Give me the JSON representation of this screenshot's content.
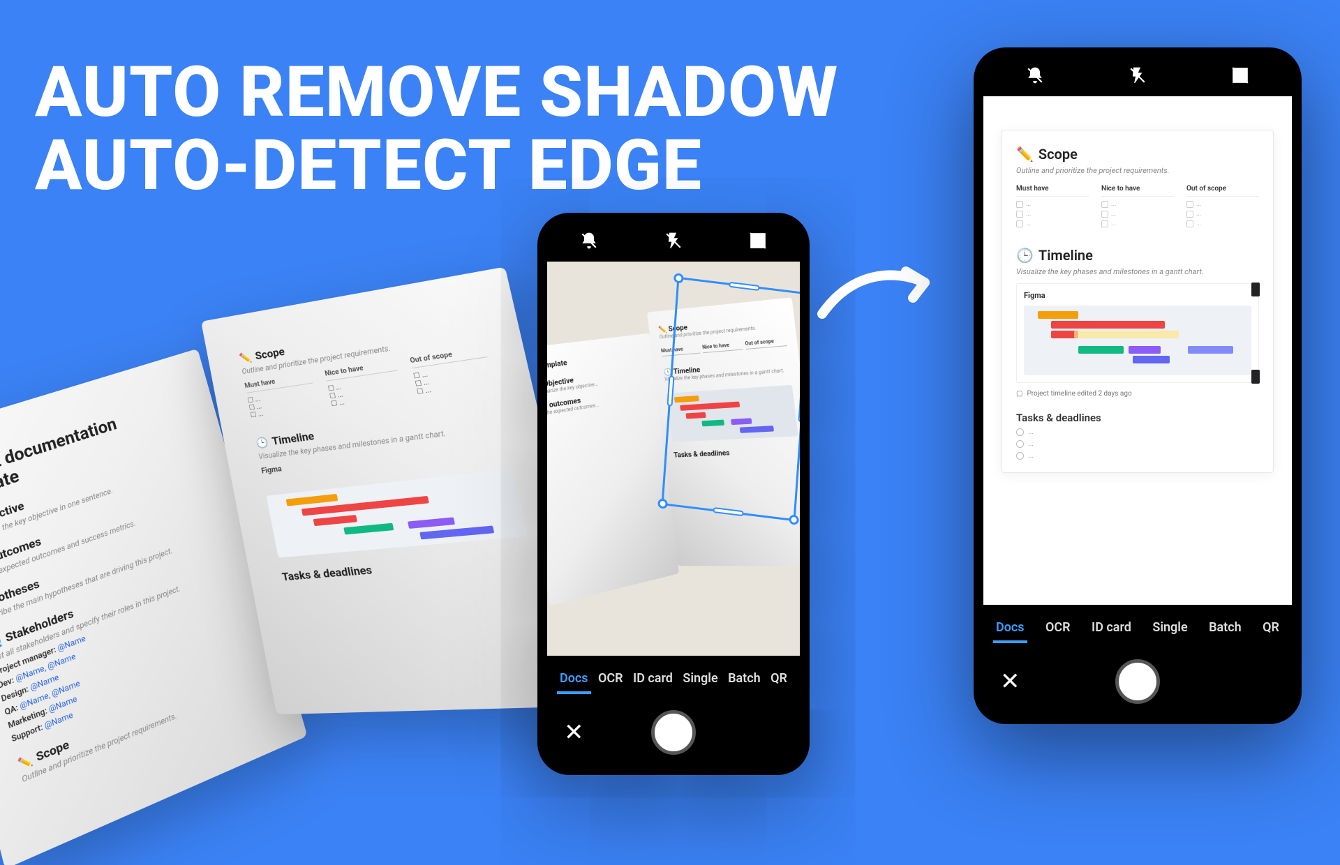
{
  "headline": {
    "line1": "AUTO REMOVE SHADOW",
    "line2": "AUTO-DETECT EDGE"
  },
  "book": {
    "title": "Project documentation template",
    "sections": {
      "objective": {
        "label": "Objective",
        "sub": "Summarize the key objective in one sentence."
      },
      "key_outcomes": {
        "label": "Key outcomes",
        "sub": "List the expected outcomes and success metrics."
      },
      "hypotheses": {
        "label": "Hypotheses",
        "sub": "Describe the main hypotheses that are driving this project."
      },
      "stakeholders": {
        "label": "Stakeholders",
        "sub": "List all stakeholders and specify their roles in this project.",
        "roles": [
          {
            "role": "Project manager:",
            "handle": "@Name"
          },
          {
            "role": "Dev:",
            "handle": "@Name, @Name"
          },
          {
            "role": "Design:",
            "handle": "@Name"
          },
          {
            "role": "QA:",
            "handle": "@Name, @Name"
          },
          {
            "role": "Marketing:",
            "handle": "@Name"
          },
          {
            "role": "Support:",
            "handle": "@Name"
          }
        ]
      },
      "scope_left": {
        "label": "Scope",
        "sub": "Outline and prioritize the project requirements."
      }
    },
    "right": {
      "scope": {
        "label": "Scope",
        "sub": "Outline and prioritize the project requirements.",
        "cols": [
          "Must have",
          "Nice to have",
          "Out of scope"
        ]
      },
      "timeline": {
        "label": "Timeline",
        "sub": "Visualize the key phases and milestones in a gantt chart.",
        "figma": "Figma"
      },
      "tasks": {
        "label": "Tasks & deadlines"
      }
    }
  },
  "camera_tabs": [
    "Docs",
    "OCR",
    "ID card",
    "Single",
    "Batch",
    "QR"
  ],
  "active_tab": "Docs",
  "result_doc": {
    "scope": {
      "label": "Scope",
      "sub": "Outline and prioritize the project requirements.",
      "cols": [
        "Must have",
        "Nice to have",
        "Out of scope"
      ]
    },
    "timeline": {
      "label": "Timeline",
      "sub": "Visualize the key phases and milestones in a gantt chart.",
      "figma": "Figma"
    },
    "note": "Project timeline edited 2 days ago",
    "tasks_label": "Tasks & deadlines"
  }
}
